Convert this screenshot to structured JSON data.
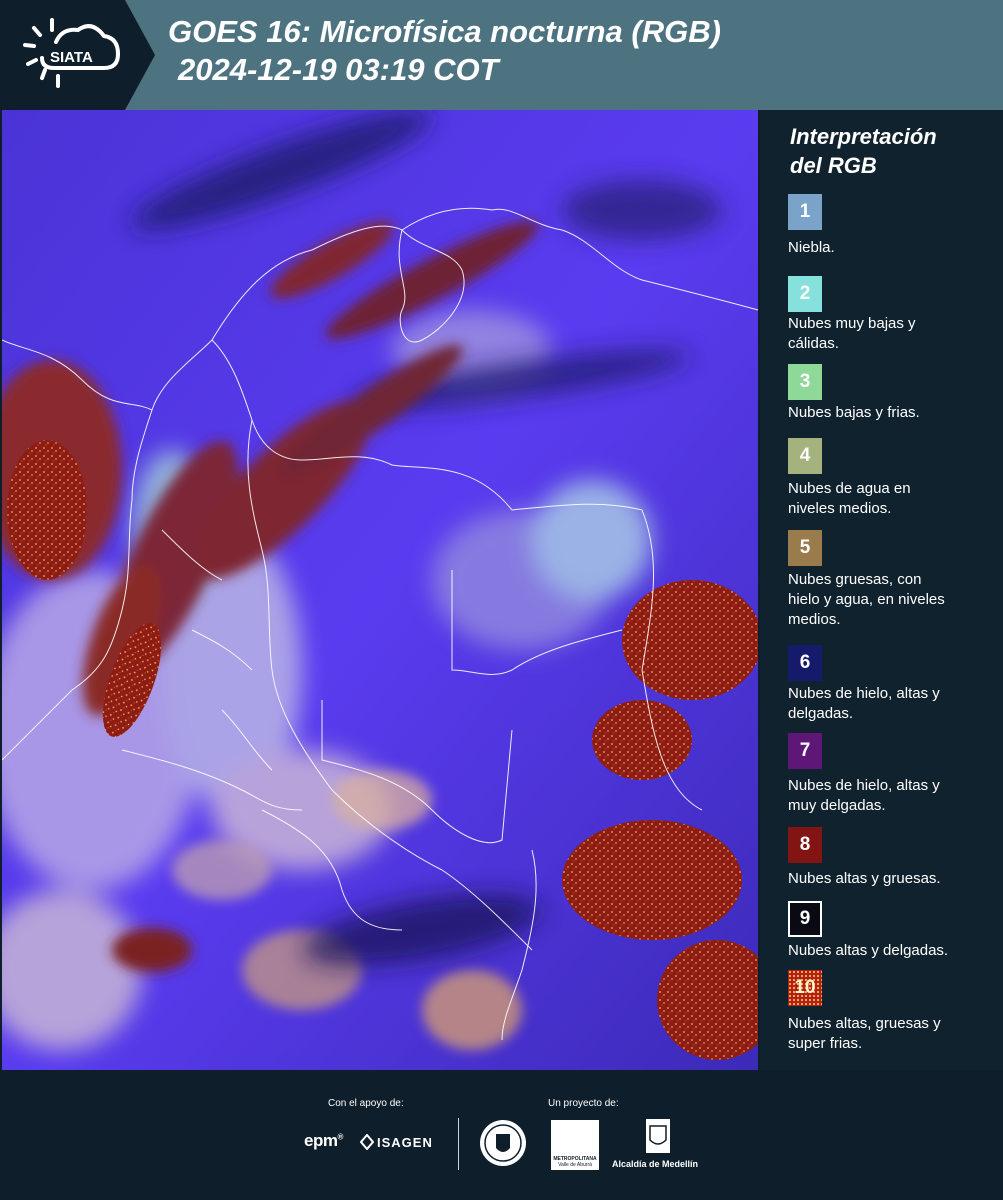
{
  "header": {
    "brand": "SIATA",
    "title_line1": "GOES 16: Microfísica nocturna (RGB)",
    "title_line2": "2024-12-19 03:19 COT"
  },
  "legend": {
    "title_line1": "Interpretación",
    "title_line2": "del RGB",
    "items": [
      {
        "num": "1",
        "label_lines": [
          "Niebla."
        ],
        "color": "#7aa3c9",
        "text_color": "#ffffff"
      },
      {
        "num": "2",
        "label_lines": [
          "Nubes muy bajas y",
          "cálidas."
        ],
        "color": "#86e1dc",
        "text_color": "#ffffff"
      },
      {
        "num": "3",
        "label_lines": [
          "Nubes bajas y frias."
        ],
        "color": "#8ed998",
        "text_color": "#ffffff"
      },
      {
        "num": "4",
        "label_lines": [
          "Nubes de agua en",
          "niveles medios."
        ],
        "color": "#a4b27d",
        "text_color": "#ffffff"
      },
      {
        "num": "5",
        "label_lines": [
          "Nubes gruesas, con",
          "hielo y agua, en niveles",
          "medios."
        ],
        "color": "#9a7b4c",
        "text_color": "#ffffff"
      },
      {
        "num": "6",
        "label_lines": [
          "Nubes de hielo, altas y",
          "delgadas."
        ],
        "color": "#151a6b",
        "text_color": "#ffffff"
      },
      {
        "num": "7",
        "label_lines": [
          "Nubes de hielo, altas y",
          "muy delgadas."
        ],
        "color": "#5e1777",
        "text_color": "#ffffff"
      },
      {
        "num": "8",
        "label_lines": [
          "Nubes altas y gruesas."
        ],
        "color": "#821414",
        "text_color": "#ffffff"
      },
      {
        "num": "9",
        "label_lines": [
          "Nubes altas y delgadas."
        ],
        "color": "#0a0a14",
        "text_color": "#ffffff"
      },
      {
        "num": "10",
        "label_lines": [
          "Nubes altas, gruesas y",
          "super frias."
        ],
        "color": "#b52015",
        "text_color": "#fff3c8"
      }
    ]
  },
  "footer": {
    "support_label": "Con el apoyo de:",
    "project_label": "Un proyecto de:",
    "sponsor1": "epm",
    "sponsor2": "ISAGEN",
    "partner1": "Área Metropolitana",
    "partner1_sub1": "METROPOLITANA",
    "partner1_sub2": "Valle de Aburrá",
    "partner2": "Alcaldía de Medellín"
  }
}
